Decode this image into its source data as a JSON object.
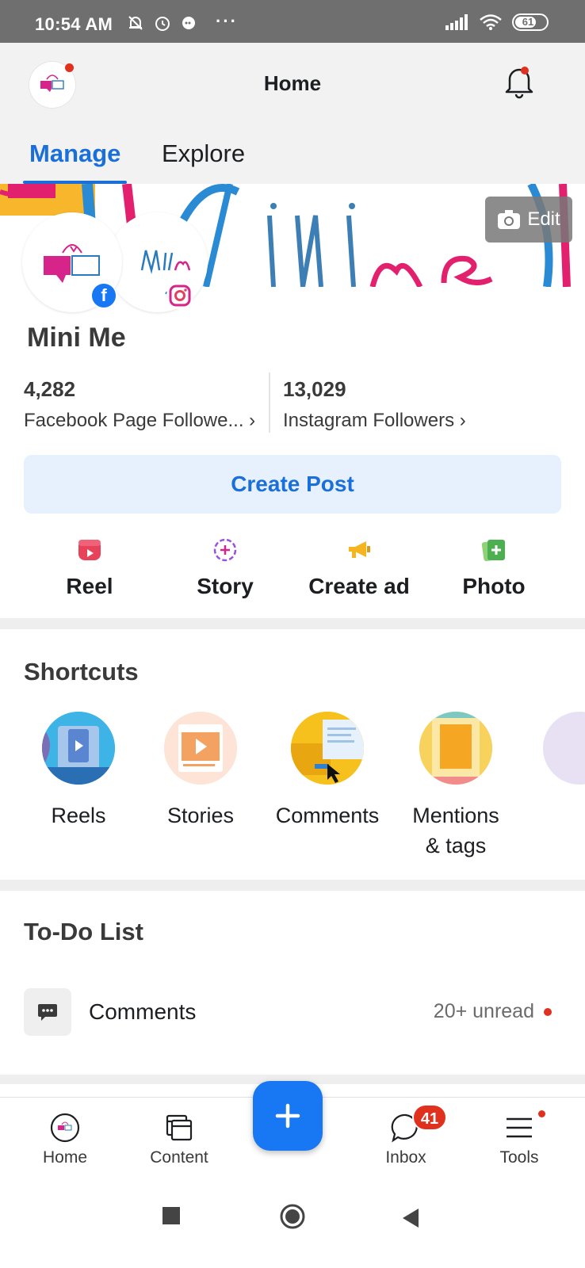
{
  "status_bar": {
    "time": "10:54 AM",
    "battery": "61"
  },
  "header": {
    "title": "Home"
  },
  "tabs": [
    {
      "label": "Manage",
      "active": true
    },
    {
      "label": "Explore",
      "active": false
    }
  ],
  "cover": {
    "edit_label": "Edit"
  },
  "page": {
    "name": "Mini Me"
  },
  "stats": {
    "facebook": {
      "count": "4,282",
      "label": "Facebook Page Followe..."
    },
    "instagram": {
      "count": "13,029",
      "label": "Instagram Followers"
    }
  },
  "create_post": "Create Post",
  "actions": [
    {
      "label": "Reel",
      "icon": "reel-icon"
    },
    {
      "label": "Story",
      "icon": "story-icon"
    },
    {
      "label": "Create ad",
      "icon": "megaphone-icon"
    },
    {
      "label": "Photo",
      "icon": "photo-add-icon"
    }
  ],
  "shortcuts": {
    "title": "Shortcuts",
    "items": [
      {
        "label": "Reels"
      },
      {
        "label": "Stories"
      },
      {
        "label": "Comments"
      },
      {
        "label": "Mentions\n& tags"
      }
    ]
  },
  "todo": {
    "title": "To-Do List",
    "items": [
      {
        "label": "Comments",
        "meta": "20+ unread"
      }
    ]
  },
  "bottom_nav": {
    "items": [
      {
        "label": "Home"
      },
      {
        "label": "Content"
      },
      {
        "label": "Inbox",
        "badge": "41"
      },
      {
        "label": "Tools"
      }
    ]
  },
  "colors": {
    "accent": "#1b6fd8",
    "fb_blue": "#1877f2",
    "alert_red": "#e0301e",
    "create_post_bg": "#e6f1fd"
  }
}
